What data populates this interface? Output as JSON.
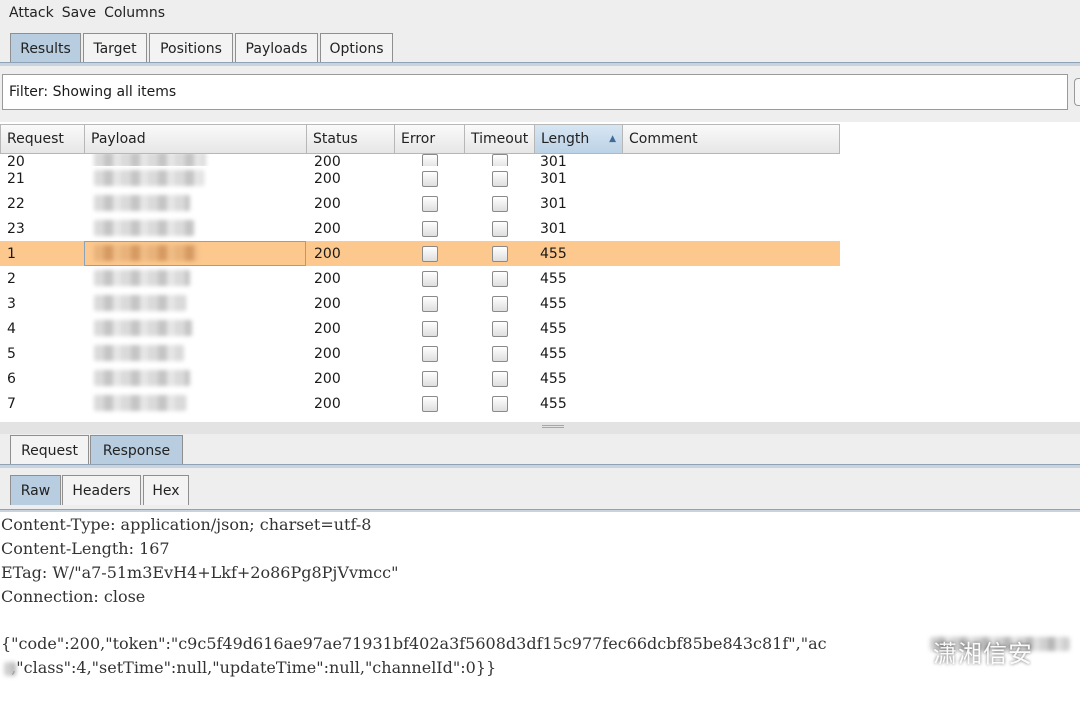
{
  "menu": [
    "Attack",
    "Save",
    "Columns"
  ],
  "top_tabs": [
    "Results",
    "Target",
    "Positions",
    "Payloads",
    "Options"
  ],
  "filter_text": "Filter: Showing all items",
  "table": {
    "headers": [
      "Request",
      "Payload",
      "Status",
      "Error",
      "Timeout",
      "Length",
      "Comment"
    ],
    "sorted_column": "Length",
    "rows": [
      {
        "request": "20",
        "status": "200",
        "length": "301"
      },
      {
        "request": "21",
        "status": "200",
        "length": "301"
      },
      {
        "request": "22",
        "status": "200",
        "length": "301"
      },
      {
        "request": "23",
        "status": "200",
        "length": "301"
      },
      {
        "request": "1",
        "status": "200",
        "length": "455"
      },
      {
        "request": "2",
        "status": "200",
        "length": "455"
      },
      {
        "request": "3",
        "status": "200",
        "length": "455"
      },
      {
        "request": "4",
        "status": "200",
        "length": "455"
      },
      {
        "request": "5",
        "status": "200",
        "length": "455"
      },
      {
        "request": "6",
        "status": "200",
        "length": "455"
      },
      {
        "request": "7",
        "status": "200",
        "length": "455"
      }
    ],
    "selected_request": "1"
  },
  "message_tabs": [
    "Request",
    "Response"
  ],
  "view_tabs": [
    "Raw",
    "Headers",
    "Hex"
  ],
  "response": {
    "lines": [
      "Content-Type: application/json; charset=utf-8",
      "Content-Length: 167",
      "ETag: W/\"a7-51m3EvH4+Lkf+2o86Pg8PjVvmcc\"",
      "Connection: close",
      "",
      "{\"code\":200,\"token\":\"c9c5f49d616ae97ae71931bf402a3f5608d3df15c977fec66dcbf85be843c81f\",\"ac",
      "  ,\"class\":4,\"setTime\":null,\"updateTime\":null,\"channelId\":0}}"
    ]
  },
  "watermark_text": "潇湘信安",
  "colors": {
    "selected_row": "#fcc88d",
    "active_tab": "#b8cde0",
    "tab_rule": "#c9d3dd"
  }
}
